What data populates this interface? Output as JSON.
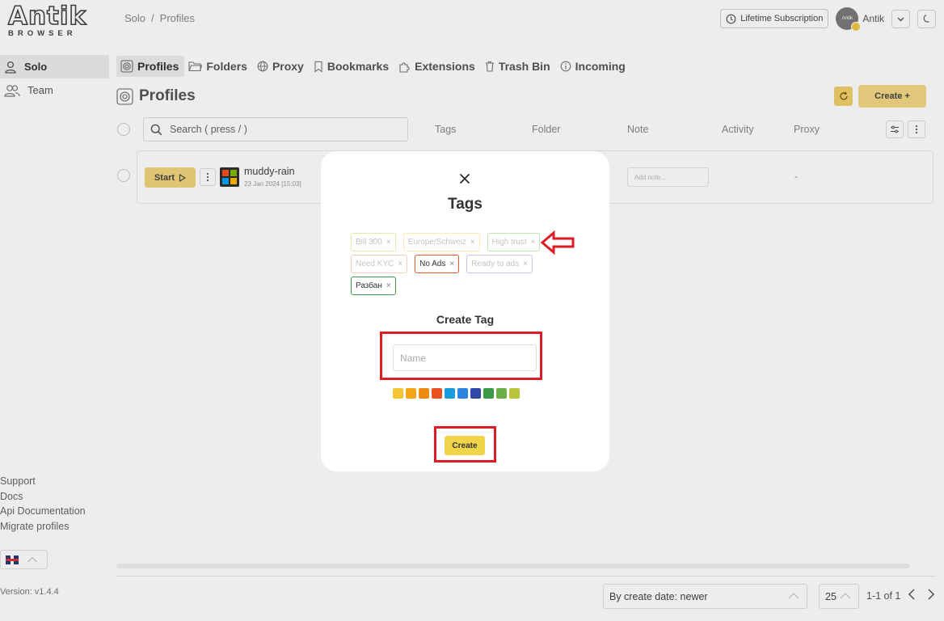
{
  "app": {
    "logo_text": "Antik",
    "logo_sub": "BROWSER",
    "breadcrumb": [
      "Solo",
      "Profiles"
    ],
    "breadcrumb_sep": "/",
    "lifetime_label": "Lifetime Subscription",
    "avatar_text": "Antik",
    "username": "Antik"
  },
  "sidebar": {
    "items": [
      {
        "label": "Solo",
        "icon": "user-icon",
        "active": true
      },
      {
        "label": "Team",
        "icon": "users-icon",
        "active": false
      }
    ],
    "links": [
      "Support",
      "Docs",
      "Api Documentation",
      "Migrate profiles"
    ],
    "version": "Version: v1.4.4"
  },
  "tabs": [
    {
      "label": "Profiles",
      "icon": "fingerprint-icon"
    },
    {
      "label": "Folders",
      "icon": "folder-icon"
    },
    {
      "label": "Proxy",
      "icon": "globe-icon"
    },
    {
      "label": "Bookmarks",
      "icon": "bookmark-icon"
    },
    {
      "label": "Extensions",
      "icon": "puzzle-icon"
    },
    {
      "label": "Trash Bin",
      "icon": "trash-icon"
    },
    {
      "label": "Incoming",
      "icon": "info-icon"
    }
  ],
  "page": {
    "title": "Profiles",
    "create_label": "Create +",
    "search_placeholder": "Search ( press / )",
    "columns": [
      "Tags",
      "Folder",
      "Note",
      "Activity",
      "Proxy"
    ]
  },
  "profile": {
    "start_label": "Start",
    "name": "muddy-rain",
    "date": "23 Jan 2024 [15:03]",
    "note_placeholder": "Add note...",
    "proxy": "-"
  },
  "footer": {
    "sort": "By create date: newer",
    "per_page": "25",
    "page_info": "1-1 of 1"
  },
  "modal": {
    "title": "Tags",
    "tags": [
      {
        "label": "Bill 300",
        "color": "#c9d65a",
        "faded": true
      },
      {
        "label": "Europe/Schweiz",
        "color": "#f0d66a",
        "faded": true
      },
      {
        "label": "High trust",
        "color": "#8cc765",
        "faded": true
      },
      {
        "label": "Need KYC",
        "color": "#f29a7a",
        "faded": true
      },
      {
        "label": "No Ads",
        "color": "#e2572a",
        "faded": false
      },
      {
        "label": "Ready to ads",
        "color": "#8d8fd6",
        "faded": true
      },
      {
        "label": "Разбан",
        "color": "#3d9d45",
        "faded": false
      }
    ],
    "create_title": "Create Tag",
    "name_placeholder": "Name",
    "swatches": [
      "#f4c636",
      "#f3a516",
      "#f08a12",
      "#e9501d",
      "#1a9be0",
      "#2a86e0",
      "#2e47a8",
      "#3a9a45",
      "#6ab046",
      "#b8c43a"
    ],
    "create_label": "Create"
  },
  "annotation_color": "#dd1c24"
}
